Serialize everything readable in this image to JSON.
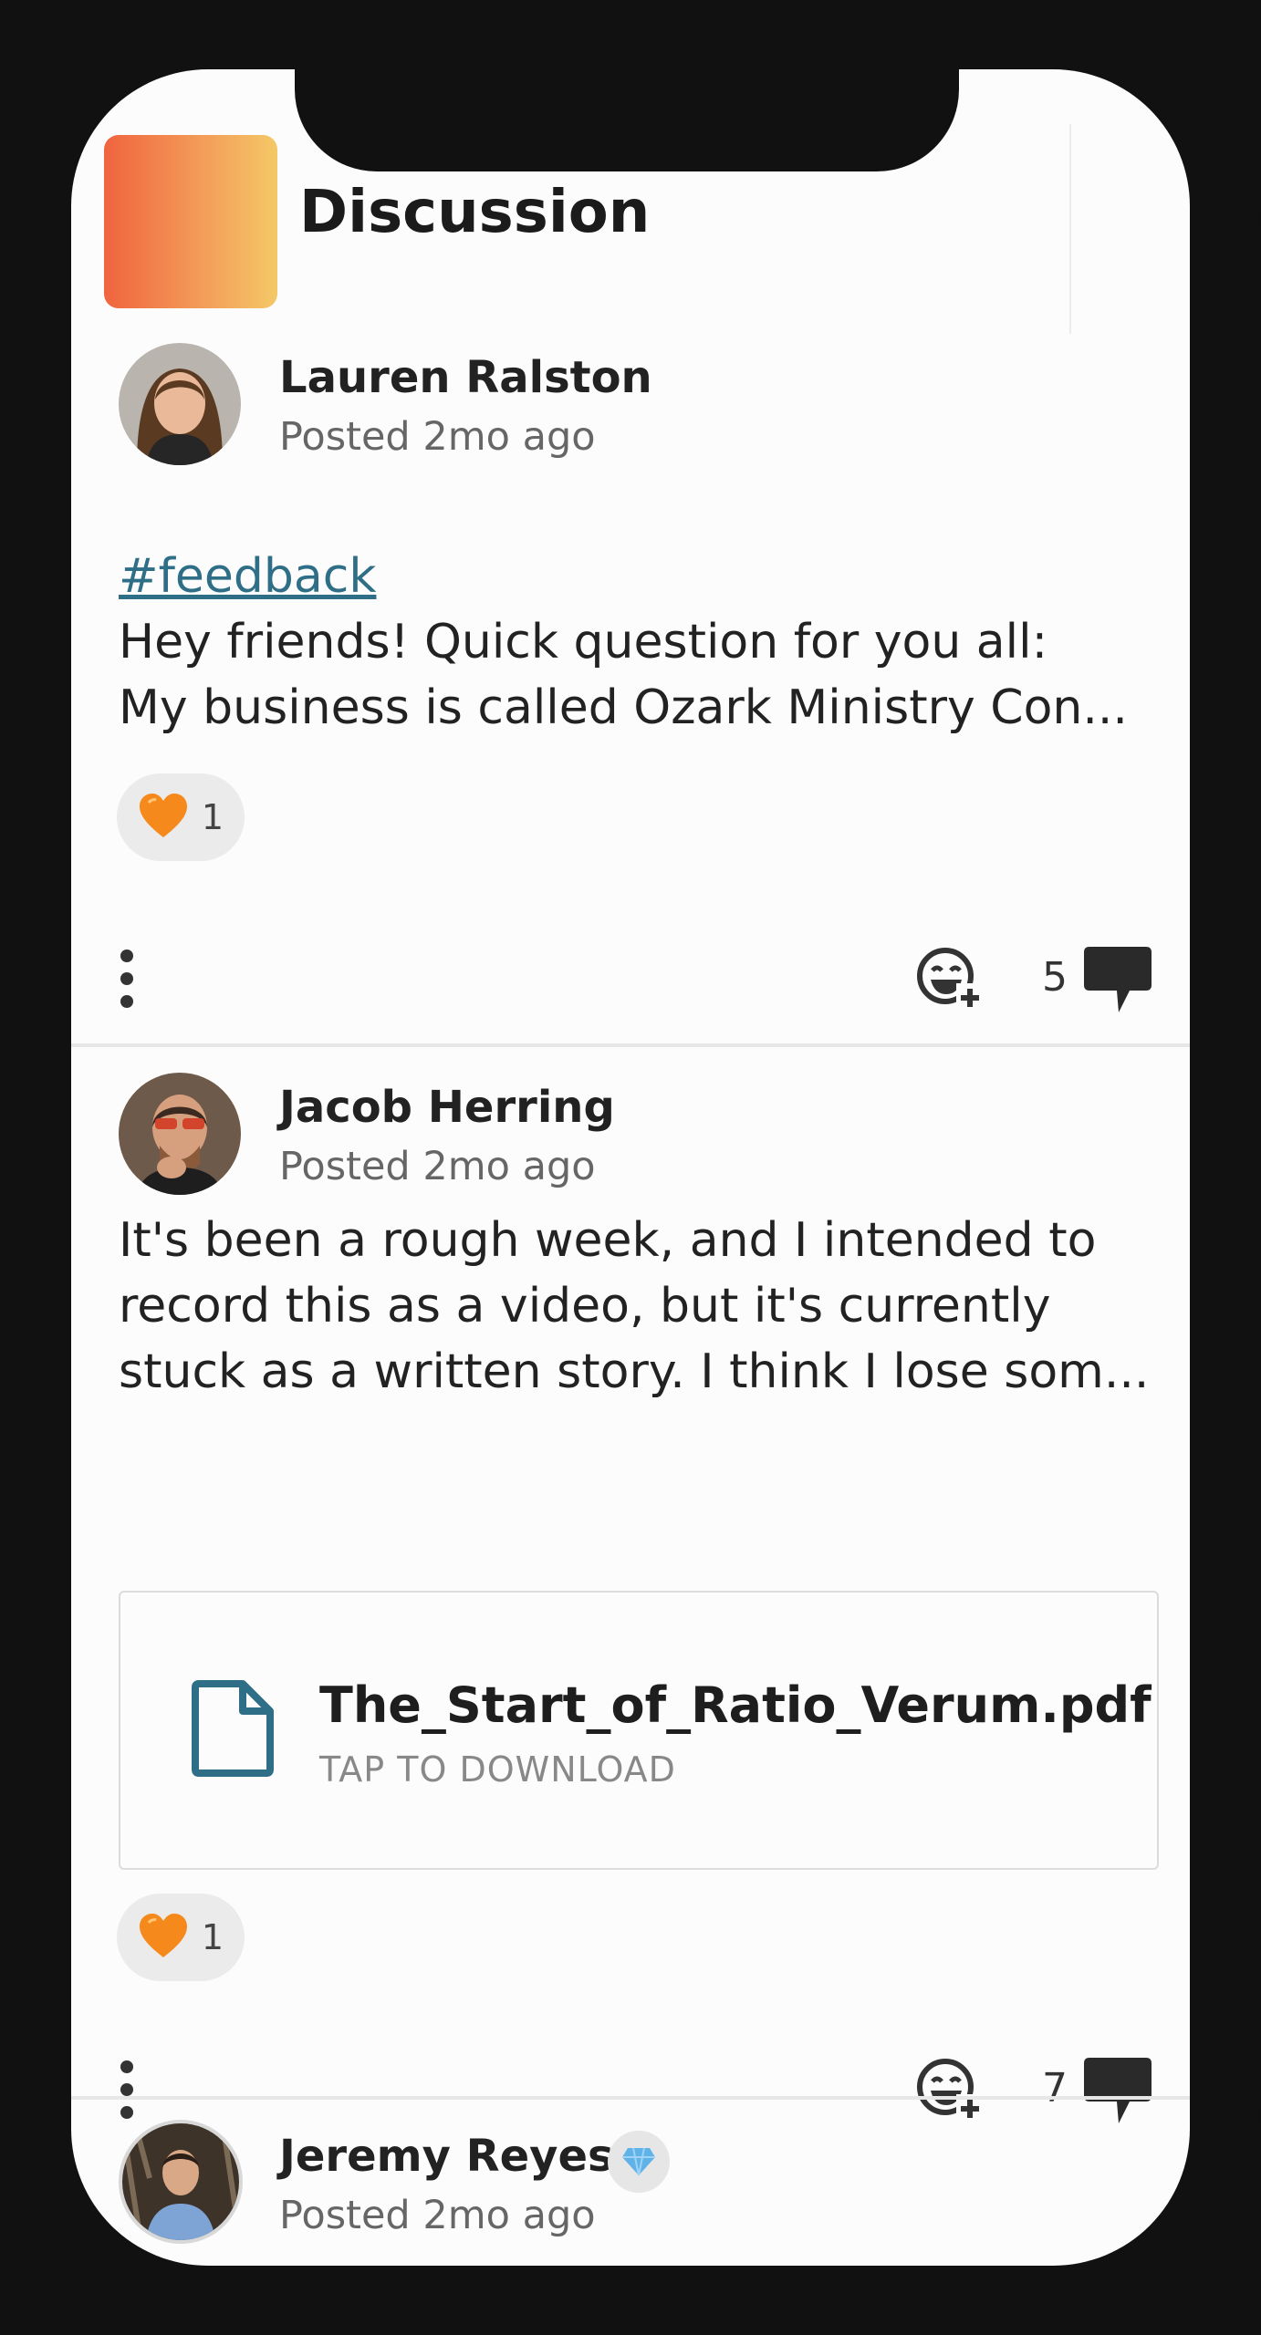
{
  "header": {
    "title": "Discussion"
  },
  "posts": [
    {
      "author": "Lauren Ralston",
      "meta": "Posted 2mo ago",
      "hashtag": "#feedback",
      "lines": [
        "Hey friends! Quick question for you all:",
        "My business is called Ozark Ministry Con..."
      ],
      "reaction_count": "1",
      "comment_count": "5"
    },
    {
      "author": "Jacob Herring",
      "meta": "Posted 2mo ago",
      "lines": [
        "It's been a rough week, and I intended to",
        "record this as a video, but it's currently",
        "stuck as a written story. I think I lose som..."
      ],
      "attachment": {
        "name": "The_Start_of_Ratio_Verum.pdf",
        "action": "TAP TO DOWNLOAD"
      },
      "reaction_count": "1",
      "comment_count": "7"
    },
    {
      "author": "Jeremy Reyes",
      "meta": "Posted 2mo ago",
      "badge_icon": "diamond-icon"
    }
  ],
  "colors": {
    "accent": "#2e6e86",
    "heart": "#f5891c",
    "logo_start": "#f0643f",
    "logo_end": "#f4c866"
  }
}
